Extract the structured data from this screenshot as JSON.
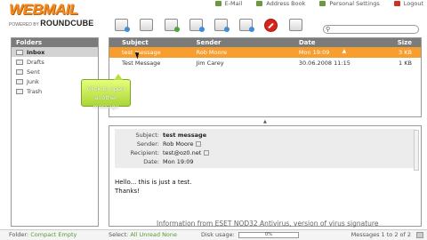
{
  "logo": {
    "title": "WEBMAIL",
    "powered": "POWERED BY",
    "brand": "ROUNDCUBE"
  },
  "topnav": [
    {
      "label": "E-Mail",
      "icon": "mail-icon"
    },
    {
      "label": "Address Book",
      "icon": "address-book-icon"
    },
    {
      "label": "Personal Settings",
      "icon": "settings-icon"
    },
    {
      "label": "Logout",
      "icon": "logout-icon"
    }
  ],
  "toolbar": [
    "get-mail-icon",
    "compose-icon",
    "address-icon",
    "reply-icon",
    "reply-all-icon",
    "forward-icon",
    "delete-icon",
    "print-icon"
  ],
  "search": {
    "value": "",
    "icon": "search-icon"
  },
  "folders": {
    "title": "Folders",
    "items": [
      {
        "label": "Inbox",
        "active": true
      },
      {
        "label": "Drafts"
      },
      {
        "label": "Sent"
      },
      {
        "label": "Junk"
      },
      {
        "label": "Trash"
      }
    ]
  },
  "list": {
    "columns": {
      "subject": "Subject",
      "sender": "Sender",
      "date": "Date",
      "sort": "▲",
      "size": "Size"
    },
    "rows": [
      {
        "subject": "test message",
        "sender": "Rob Moore",
        "date": "Mon 19:09",
        "size": "3 KB"
      },
      {
        "subject": "Test Message",
        "sender": "Jim Carey",
        "date": "30.06.2008 11:15",
        "size": "1 KB"
      }
    ]
  },
  "callout": {
    "line1": "Click to open",
    "line2": "another message"
  },
  "preview": {
    "subject_label": "Subject:",
    "subject": "test message",
    "sender_label": "Sender:",
    "sender": "Rob Moore",
    "recipient_label": "Recipient:",
    "recipient": "test@oz0.net",
    "date_label": "Date:",
    "date": "Mon 19:09",
    "body_line1": "Hello... this is just a test.",
    "body_line2": "Thanks!"
  },
  "notice": "Information from ESET NOD32 Antivirus, version of virus signature",
  "status": {
    "folder_label": "Folder:",
    "compact": "Compact",
    "empty": "Empty",
    "select_label": "Select:",
    "all": "All",
    "unread": "Unread",
    "none": "None",
    "disk_label": "Disk usage:",
    "disk_value": "0%",
    "messages": "Messages 1 to 2 of 2"
  },
  "colors": {
    "accent": "#f89e2f",
    "header": "#7b7b7b",
    "callout": "#a8d637",
    "brand": "#f48a1e"
  }
}
